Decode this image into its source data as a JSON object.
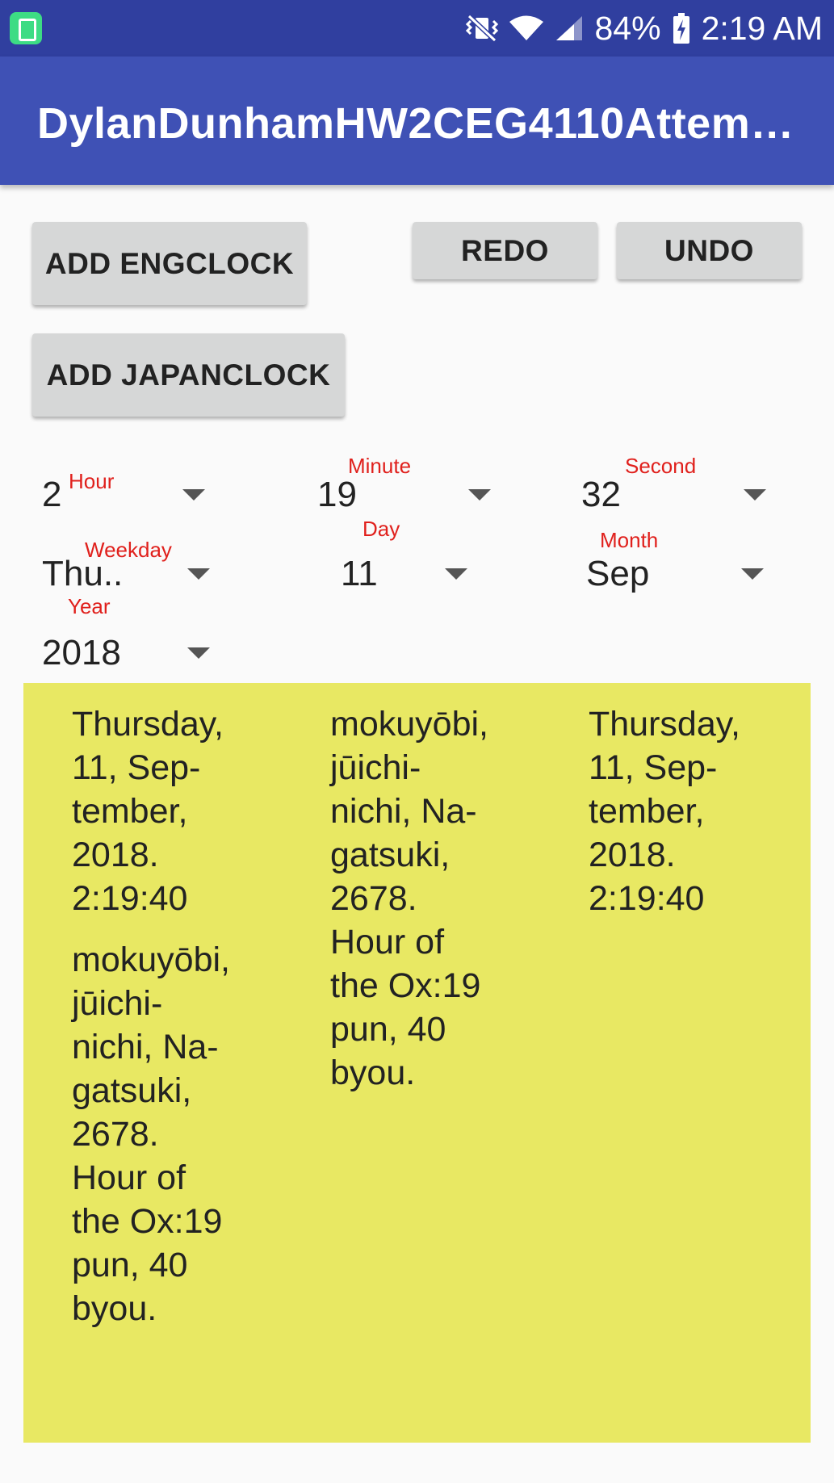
{
  "status_bar": {
    "battery": "84%",
    "time": "2:19 AM"
  },
  "app_bar": {
    "title": "DylanDunhamHW2CEG4110Attem…"
  },
  "buttons": {
    "add_engclock": "ADD ENGCLOCK",
    "redo": "REDO",
    "undo": "UNDO",
    "add_japanclock": "ADD JAPANCLOCK"
  },
  "spinners": {
    "hour": {
      "label": "Hour",
      "value": "2"
    },
    "minute": {
      "label": "Minute",
      "value": "19"
    },
    "second": {
      "label": "Second",
      "value": "32"
    },
    "weekday": {
      "label": "Weekday",
      "value": "Thu.."
    },
    "day": {
      "label": "Day",
      "value": "11"
    },
    "month": {
      "label": "Month",
      "value": "Sep"
    },
    "year": {
      "label": "Year",
      "value": "2018"
    }
  },
  "clocks": {
    "col1_eng": "Thursday,\n11, Sep-\ntember,\n2018.\n2:19:40",
    "col1_jap": "mokuyōbi,\njūichi-\nnichi, Na-\ngatsuki,\n2678.\nHour of\nthe Ox:19\npun, 40\nbyou.",
    "col2_jap": "mokuyōbi,\njūichi-\nnichi, Na-\ngatsuki,\n2678.\nHour of\nthe Ox:19\npun, 40\nbyou.",
    "col3_eng": "Thursday,\n11, Sep-\ntember,\n2018.\n2:19:40"
  },
  "colors": {
    "status_bar": "#303f9f",
    "app_bar": "#3f51b5",
    "button": "#d6d7d7",
    "label_red": "#e0201c",
    "clock_panel": "#e8e863"
  }
}
